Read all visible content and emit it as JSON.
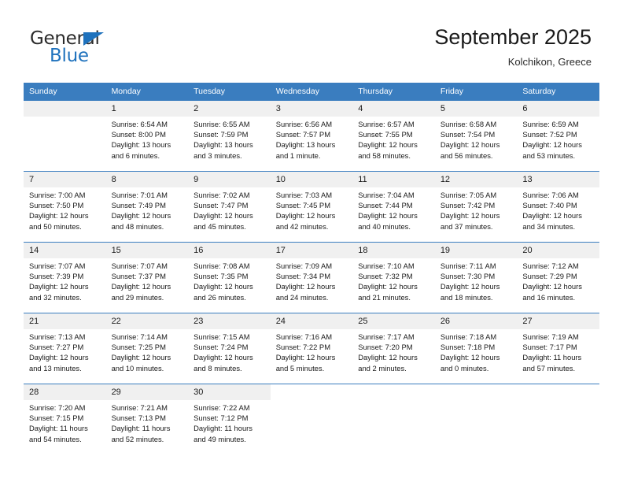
{
  "brand": {
    "name_top": "General",
    "name_bottom": "Blue",
    "accent_color": "#1f72bd"
  },
  "header": {
    "title": "September 2025",
    "subtitle": "Kolchikon, Greece"
  },
  "theme": {
    "header_row_bg": "#3a7dbf",
    "daynum_bg": "#f0f0f0",
    "grid_line": "#3a7dbf",
    "text": "#1a1a1a"
  },
  "weekdays": [
    "Sunday",
    "Monday",
    "Tuesday",
    "Wednesday",
    "Thursday",
    "Friday",
    "Saturday"
  ],
  "labels": {
    "sunrise_prefix": "Sunrise:",
    "sunset_prefix": "Sunset:",
    "daylight_prefix": "Daylight:"
  },
  "weeks": [
    [
      {
        "day": "",
        "sunrise": "",
        "sunset": "",
        "daylight_line1": "",
        "daylight_line2": ""
      },
      {
        "day": "1",
        "sunrise": "Sunrise: 6:54 AM",
        "sunset": "Sunset: 8:00 PM",
        "daylight_line1": "Daylight: 13 hours",
        "daylight_line2": "and 6 minutes."
      },
      {
        "day": "2",
        "sunrise": "Sunrise: 6:55 AM",
        "sunset": "Sunset: 7:59 PM",
        "daylight_line1": "Daylight: 13 hours",
        "daylight_line2": "and 3 minutes."
      },
      {
        "day": "3",
        "sunrise": "Sunrise: 6:56 AM",
        "sunset": "Sunset: 7:57 PM",
        "daylight_line1": "Daylight: 13 hours",
        "daylight_line2": "and 1 minute."
      },
      {
        "day": "4",
        "sunrise": "Sunrise: 6:57 AM",
        "sunset": "Sunset: 7:55 PM",
        "daylight_line1": "Daylight: 12 hours",
        "daylight_line2": "and 58 minutes."
      },
      {
        "day": "5",
        "sunrise": "Sunrise: 6:58 AM",
        "sunset": "Sunset: 7:54 PM",
        "daylight_line1": "Daylight: 12 hours",
        "daylight_line2": "and 56 minutes."
      },
      {
        "day": "6",
        "sunrise": "Sunrise: 6:59 AM",
        "sunset": "Sunset: 7:52 PM",
        "daylight_line1": "Daylight: 12 hours",
        "daylight_line2": "and 53 minutes."
      }
    ],
    [
      {
        "day": "7",
        "sunrise": "Sunrise: 7:00 AM",
        "sunset": "Sunset: 7:50 PM",
        "daylight_line1": "Daylight: 12 hours",
        "daylight_line2": "and 50 minutes."
      },
      {
        "day": "8",
        "sunrise": "Sunrise: 7:01 AM",
        "sunset": "Sunset: 7:49 PM",
        "daylight_line1": "Daylight: 12 hours",
        "daylight_line2": "and 48 minutes."
      },
      {
        "day": "9",
        "sunrise": "Sunrise: 7:02 AM",
        "sunset": "Sunset: 7:47 PM",
        "daylight_line1": "Daylight: 12 hours",
        "daylight_line2": "and 45 minutes."
      },
      {
        "day": "10",
        "sunrise": "Sunrise: 7:03 AM",
        "sunset": "Sunset: 7:45 PM",
        "daylight_line1": "Daylight: 12 hours",
        "daylight_line2": "and 42 minutes."
      },
      {
        "day": "11",
        "sunrise": "Sunrise: 7:04 AM",
        "sunset": "Sunset: 7:44 PM",
        "daylight_line1": "Daylight: 12 hours",
        "daylight_line2": "and 40 minutes."
      },
      {
        "day": "12",
        "sunrise": "Sunrise: 7:05 AM",
        "sunset": "Sunset: 7:42 PM",
        "daylight_line1": "Daylight: 12 hours",
        "daylight_line2": "and 37 minutes."
      },
      {
        "day": "13",
        "sunrise": "Sunrise: 7:06 AM",
        "sunset": "Sunset: 7:40 PM",
        "daylight_line1": "Daylight: 12 hours",
        "daylight_line2": "and 34 minutes."
      }
    ],
    [
      {
        "day": "14",
        "sunrise": "Sunrise: 7:07 AM",
        "sunset": "Sunset: 7:39 PM",
        "daylight_line1": "Daylight: 12 hours",
        "daylight_line2": "and 32 minutes."
      },
      {
        "day": "15",
        "sunrise": "Sunrise: 7:07 AM",
        "sunset": "Sunset: 7:37 PM",
        "daylight_line1": "Daylight: 12 hours",
        "daylight_line2": "and 29 minutes."
      },
      {
        "day": "16",
        "sunrise": "Sunrise: 7:08 AM",
        "sunset": "Sunset: 7:35 PM",
        "daylight_line1": "Daylight: 12 hours",
        "daylight_line2": "and 26 minutes."
      },
      {
        "day": "17",
        "sunrise": "Sunrise: 7:09 AM",
        "sunset": "Sunset: 7:34 PM",
        "daylight_line1": "Daylight: 12 hours",
        "daylight_line2": "and 24 minutes."
      },
      {
        "day": "18",
        "sunrise": "Sunrise: 7:10 AM",
        "sunset": "Sunset: 7:32 PM",
        "daylight_line1": "Daylight: 12 hours",
        "daylight_line2": "and 21 minutes."
      },
      {
        "day": "19",
        "sunrise": "Sunrise: 7:11 AM",
        "sunset": "Sunset: 7:30 PM",
        "daylight_line1": "Daylight: 12 hours",
        "daylight_line2": "and 18 minutes."
      },
      {
        "day": "20",
        "sunrise": "Sunrise: 7:12 AM",
        "sunset": "Sunset: 7:29 PM",
        "daylight_line1": "Daylight: 12 hours",
        "daylight_line2": "and 16 minutes."
      }
    ],
    [
      {
        "day": "21",
        "sunrise": "Sunrise: 7:13 AM",
        "sunset": "Sunset: 7:27 PM",
        "daylight_line1": "Daylight: 12 hours",
        "daylight_line2": "and 13 minutes."
      },
      {
        "day": "22",
        "sunrise": "Sunrise: 7:14 AM",
        "sunset": "Sunset: 7:25 PM",
        "daylight_line1": "Daylight: 12 hours",
        "daylight_line2": "and 10 minutes."
      },
      {
        "day": "23",
        "sunrise": "Sunrise: 7:15 AM",
        "sunset": "Sunset: 7:24 PM",
        "daylight_line1": "Daylight: 12 hours",
        "daylight_line2": "and 8 minutes."
      },
      {
        "day": "24",
        "sunrise": "Sunrise: 7:16 AM",
        "sunset": "Sunset: 7:22 PM",
        "daylight_line1": "Daylight: 12 hours",
        "daylight_line2": "and 5 minutes."
      },
      {
        "day": "25",
        "sunrise": "Sunrise: 7:17 AM",
        "sunset": "Sunset: 7:20 PM",
        "daylight_line1": "Daylight: 12 hours",
        "daylight_line2": "and 2 minutes."
      },
      {
        "day": "26",
        "sunrise": "Sunrise: 7:18 AM",
        "sunset": "Sunset: 7:18 PM",
        "daylight_line1": "Daylight: 12 hours",
        "daylight_line2": "and 0 minutes."
      },
      {
        "day": "27",
        "sunrise": "Sunrise: 7:19 AM",
        "sunset": "Sunset: 7:17 PM",
        "daylight_line1": "Daylight: 11 hours",
        "daylight_line2": "and 57 minutes."
      }
    ],
    [
      {
        "day": "28",
        "sunrise": "Sunrise: 7:20 AM",
        "sunset": "Sunset: 7:15 PM",
        "daylight_line1": "Daylight: 11 hours",
        "daylight_line2": "and 54 minutes."
      },
      {
        "day": "29",
        "sunrise": "Sunrise: 7:21 AM",
        "sunset": "Sunset: 7:13 PM",
        "daylight_line1": "Daylight: 11 hours",
        "daylight_line2": "and 52 minutes."
      },
      {
        "day": "30",
        "sunrise": "Sunrise: 7:22 AM",
        "sunset": "Sunset: 7:12 PM",
        "daylight_line1": "Daylight: 11 hours",
        "daylight_line2": "and 49 minutes."
      },
      {
        "day": "",
        "sunrise": "",
        "sunset": "",
        "daylight_line1": "",
        "daylight_line2": ""
      },
      {
        "day": "",
        "sunrise": "",
        "sunset": "",
        "daylight_line1": "",
        "daylight_line2": ""
      },
      {
        "day": "",
        "sunrise": "",
        "sunset": "",
        "daylight_line1": "",
        "daylight_line2": ""
      },
      {
        "day": "",
        "sunrise": "",
        "sunset": "",
        "daylight_line1": "",
        "daylight_line2": ""
      }
    ]
  ]
}
